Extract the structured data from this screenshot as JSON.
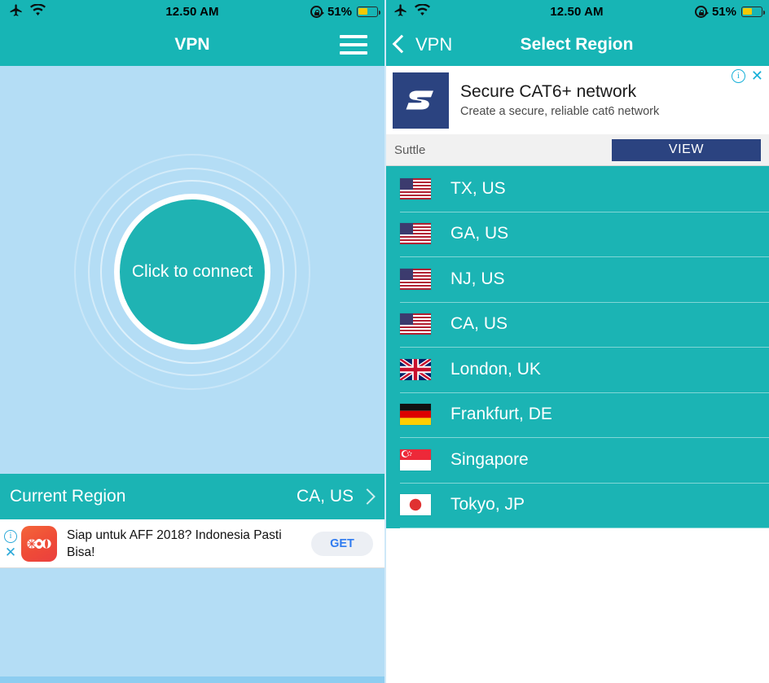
{
  "status_bar": {
    "airplane_icon": "airplane-mode-icon",
    "wifi_icon": "wifi-icon",
    "time": "12.50 AM",
    "rotation_lock_icon": "rotation-lock-icon",
    "battery_percent": "51%",
    "battery_level": 51,
    "battery_color": "#f6c800"
  },
  "left_screen": {
    "nav": {
      "title": "VPN",
      "menu_icon": "hamburger-menu-icon"
    },
    "connect": {
      "button_label": "Click to connect"
    },
    "current_region": {
      "label": "Current Region",
      "value": "CA, US",
      "chevron_icon": "chevron-right-icon"
    },
    "ad": {
      "info_icon": "ad-info-icon",
      "close_icon": "ad-close-icon",
      "app_icon": "ad-app-icon",
      "text": "Siap untuk AFF 2018? Indonesia Pasti Bisa!",
      "cta_label": "GET"
    },
    "colors": {
      "teal": "#1bb4b4",
      "light_blue": "#b4ddf5"
    }
  },
  "right_screen": {
    "nav": {
      "back_label": "VPN",
      "back_icon": "chevron-left-icon",
      "title": "Select Region"
    },
    "ad": {
      "info_icon": "ad-info-icon",
      "close_icon": "ad-close-icon",
      "logo_icon": "suttle-logo-icon",
      "headline": "Secure CAT6+ network",
      "description": "Create a secure, reliable cat6 network",
      "advertiser": "Suttle",
      "cta_label": "VIEW",
      "brand_color": "#2b4380"
    },
    "regions": [
      {
        "flag": "us-flag-icon",
        "name": "TX, US"
      },
      {
        "flag": "us-flag-icon",
        "name": "GA, US"
      },
      {
        "flag": "us-flag-icon",
        "name": "NJ, US"
      },
      {
        "flag": "us-flag-icon",
        "name": "CA, US"
      },
      {
        "flag": "uk-flag-icon",
        "name": "London, UK"
      },
      {
        "flag": "de-flag-icon",
        "name": "Frankfurt, DE"
      },
      {
        "flag": "sg-flag-icon",
        "name": "Singapore"
      },
      {
        "flag": "jp-flag-icon",
        "name": "Tokyo, JP"
      }
    ]
  }
}
